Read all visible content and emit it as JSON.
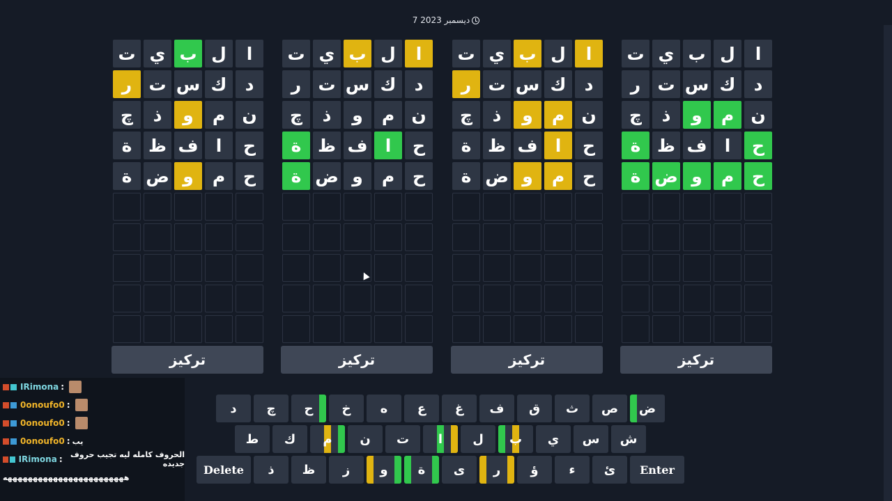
{
  "header": {
    "date": "7 ديسمبر 2023"
  },
  "colors": {
    "yellow": "#e0b411",
    "green": "#31c84d",
    "tile": "#2e3644",
    "background": "#151b26"
  },
  "boards": [
    {
      "focus_label": "تركيز",
      "rows": [
        [
          [
            "ا",
            ""
          ],
          [
            "ل",
            ""
          ],
          [
            "ب",
            "g"
          ],
          [
            "ي",
            ""
          ],
          [
            "ت",
            ""
          ]
        ],
        [
          [
            "د",
            ""
          ],
          [
            "ك",
            ""
          ],
          [
            "س",
            ""
          ],
          [
            "ت",
            ""
          ],
          [
            "ر",
            "y"
          ]
        ],
        [
          [
            "ن",
            ""
          ],
          [
            "م",
            ""
          ],
          [
            "و",
            "y"
          ],
          [
            "ذ",
            ""
          ],
          [
            "چ",
            ""
          ]
        ],
        [
          [
            "ح",
            ""
          ],
          [
            "ا",
            ""
          ],
          [
            "ف",
            ""
          ],
          [
            "ظ",
            ""
          ],
          [
            "ة",
            ""
          ]
        ],
        [
          [
            "ح",
            ""
          ],
          [
            "م",
            ""
          ],
          [
            "و",
            "y"
          ],
          [
            "ض",
            ""
          ],
          [
            "ة",
            ""
          ]
        ]
      ]
    },
    {
      "focus_label": "تركيز",
      "rows": [
        [
          [
            "ا",
            "y"
          ],
          [
            "ل",
            ""
          ],
          [
            "ب",
            "y"
          ],
          [
            "ي",
            ""
          ],
          [
            "ت",
            ""
          ]
        ],
        [
          [
            "د",
            ""
          ],
          [
            "ك",
            ""
          ],
          [
            "س",
            ""
          ],
          [
            "ت",
            ""
          ],
          [
            "ر",
            ""
          ]
        ],
        [
          [
            "ن",
            ""
          ],
          [
            "م",
            ""
          ],
          [
            "و",
            ""
          ],
          [
            "ذ",
            ""
          ],
          [
            "چ",
            ""
          ]
        ],
        [
          [
            "ح",
            ""
          ],
          [
            "ا",
            "g"
          ],
          [
            "ف",
            ""
          ],
          [
            "ظ",
            ""
          ],
          [
            "ة",
            "g"
          ]
        ],
        [
          [
            "ح",
            ""
          ],
          [
            "م",
            ""
          ],
          [
            "و",
            ""
          ],
          [
            "ض",
            ""
          ],
          [
            "ة",
            "g"
          ]
        ]
      ]
    },
    {
      "focus_label": "تركيز",
      "rows": [
        [
          [
            "ا",
            "y"
          ],
          [
            "ل",
            ""
          ],
          [
            "ب",
            "y"
          ],
          [
            "ي",
            ""
          ],
          [
            "ت",
            ""
          ]
        ],
        [
          [
            "د",
            ""
          ],
          [
            "ك",
            ""
          ],
          [
            "س",
            ""
          ],
          [
            "ت",
            ""
          ],
          [
            "ر",
            "y"
          ]
        ],
        [
          [
            "ن",
            ""
          ],
          [
            "م",
            "y"
          ],
          [
            "و",
            "y"
          ],
          [
            "ذ",
            ""
          ],
          [
            "چ",
            ""
          ]
        ],
        [
          [
            "ح",
            ""
          ],
          [
            "ا",
            "y"
          ],
          [
            "ف",
            ""
          ],
          [
            "ظ",
            ""
          ],
          [
            "ة",
            ""
          ]
        ],
        [
          [
            "ح",
            ""
          ],
          [
            "م",
            "y"
          ],
          [
            "و",
            "y"
          ],
          [
            "ض",
            ""
          ],
          [
            "ة",
            ""
          ]
        ]
      ]
    },
    {
      "focus_label": "تركيز",
      "rows": [
        [
          [
            "ا",
            ""
          ],
          [
            "ل",
            ""
          ],
          [
            "ب",
            ""
          ],
          [
            "ي",
            ""
          ],
          [
            "ت",
            ""
          ]
        ],
        [
          [
            "د",
            ""
          ],
          [
            "ك",
            ""
          ],
          [
            "س",
            ""
          ],
          [
            "ت",
            ""
          ],
          [
            "ر",
            ""
          ]
        ],
        [
          [
            "ن",
            ""
          ],
          [
            "م",
            "g"
          ],
          [
            "و",
            "g"
          ],
          [
            "ذ",
            ""
          ],
          [
            "چ",
            ""
          ]
        ],
        [
          [
            "ح",
            "g"
          ],
          [
            "ا",
            ""
          ],
          [
            "ف",
            ""
          ],
          [
            "ظ",
            ""
          ],
          [
            "ة",
            "g"
          ]
        ],
        [
          [
            "ح",
            "g"
          ],
          [
            "م",
            "g"
          ],
          [
            "و",
            "g"
          ],
          [
            "ض",
            "g"
          ],
          [
            "ة",
            "g"
          ]
        ]
      ]
    }
  ],
  "keyboard": {
    "row1": [
      [
        "ض",
        [
          [
            "g",
            "left"
          ]
        ]
      ],
      [
        "ص",
        []
      ],
      [
        "ث",
        []
      ],
      [
        "ق",
        []
      ],
      [
        "ف",
        []
      ],
      [
        "غ",
        []
      ],
      [
        "ع",
        []
      ],
      [
        "ه",
        []
      ],
      [
        "خ",
        []
      ],
      [
        "ح",
        [
          [
            "g",
            "right"
          ]
        ]
      ],
      [
        "چ",
        []
      ],
      [
        "د",
        []
      ]
    ],
    "row2": [
      [
        "ش",
        []
      ],
      [
        "س",
        []
      ],
      [
        "ي",
        []
      ],
      [
        "ب",
        [
          [
            "g",
            "left"
          ],
          [
            "y",
            "mid"
          ]
        ]
      ],
      [
        "ل",
        []
      ],
      [
        "ا",
        [
          [
            "g",
            "mid"
          ],
          [
            "y",
            "right"
          ]
        ]
      ],
      [
        "ت",
        []
      ],
      [
        "ن",
        []
      ],
      [
        "م",
        [
          [
            "y",
            "mid"
          ],
          [
            "g",
            "right"
          ]
        ]
      ],
      [
        "ك",
        []
      ],
      [
        "ط",
        []
      ]
    ],
    "row3_enter": "Enter",
    "row3_delete": "Delete",
    "row3": [
      [
        "ئ",
        []
      ],
      [
        "ء",
        []
      ],
      [
        "ؤ",
        []
      ],
      [
        "ر",
        [
          [
            "y",
            "left"
          ],
          [
            "y",
            "right"
          ]
        ]
      ],
      [
        "ى",
        []
      ],
      [
        "ة",
        [
          [
            "g",
            "left"
          ],
          [
            "g",
            "right"
          ]
        ]
      ],
      [
        "و",
        [
          [
            "y",
            "left"
          ],
          [
            "g",
            "right"
          ]
        ]
      ],
      [
        "ز",
        []
      ],
      [
        "ظ",
        []
      ],
      [
        "ذ",
        []
      ]
    ]
  },
  "chat": [
    {
      "user": "IRimona",
      "color": "#7ed6e0",
      "text": "",
      "avatar": true
    },
    {
      "user": "0onoufo0",
      "color": "#f0b429",
      "text": "",
      "avatar": true
    },
    {
      "user": "0onoufo0",
      "color": "#f0b429",
      "text": "",
      "avatar": true
    },
    {
      "user": "0onoufo0",
      "color": "#f0b429",
      "text": "يب",
      "avatar": false
    },
    {
      "user": "IRimona",
      "color": "#7ed6e0",
      "text": "الحروف كامله ليه تجيب حروف جديده",
      "avatar": false
    }
  ],
  "chat_tail": "ههههههههههههههههههههههههه"
}
